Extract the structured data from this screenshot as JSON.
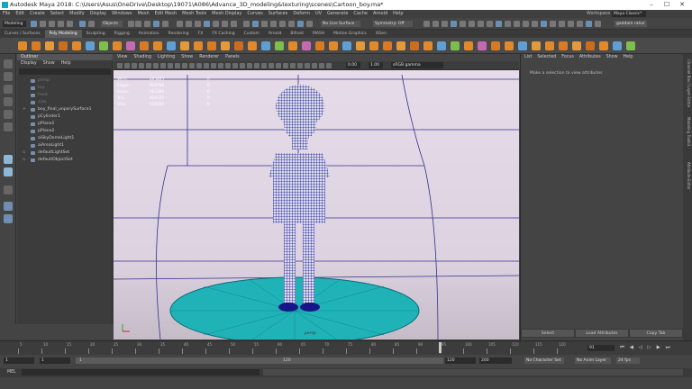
{
  "window": {
    "title": "Autodesk Maya 2018: C:\\Users\\Asus\\OneDrive\\Desktop\\19071\\A086\\Advance_3D_modeling&texturing\\scenes\\Cartoon_boy.ma*",
    "min": "–",
    "max": "☐",
    "close": "✕"
  },
  "menubar": {
    "items": [
      "File",
      "Edit",
      "Create",
      "Select",
      "Modify",
      "Display",
      "Windows",
      "Mesh",
      "Edit Mesh",
      "Mesh Tools",
      "Mesh Display",
      "Curves",
      "Surfaces",
      "Deform",
      "UV",
      "Generate",
      "Cache",
      "Arnold",
      "Help"
    ],
    "workspace_label": "Workspace :",
    "workspace_value": "Maya Classic*"
  },
  "statusline": {
    "mode": "Modeling",
    "objects": "Objects",
    "no_live_surface": "No Live Surface",
    "symmetry": "Symmetry: Off",
    "user": "gaddam rahul"
  },
  "shelf": {
    "tabs": [
      "Curves / Surfaces",
      "Poly Modeling",
      "Sculpting",
      "Rigging",
      "Animation",
      "Rendering",
      "FX",
      "FX Caching",
      "Custom",
      "Arnold",
      "Bifrost",
      "MASH",
      "Motion Graphics",
      "XGen"
    ],
    "active": "Poly Modeling"
  },
  "outliner": {
    "title": "Outliner",
    "menu": [
      "Display",
      "Show",
      "Help"
    ],
    "items": [
      {
        "label": "persp",
        "dim": true
      },
      {
        "label": "top",
        "dim": true
      },
      {
        "label": "front",
        "dim": true
      },
      {
        "label": "side",
        "dim": true
      },
      {
        "label": "boy_final_unparySurface1",
        "expand": "+"
      },
      {
        "label": "pCylinder1"
      },
      {
        "label": "pPlane1"
      },
      {
        "label": "pPlane2"
      },
      {
        "label": "aiSkyDomeLight1"
      },
      {
        "label": "aiAreaLight1"
      },
      {
        "label": "defaultLightSet",
        "expand": "▫"
      },
      {
        "label": "defaultObjectSet",
        "expand": "▫"
      }
    ]
  },
  "viewport": {
    "menu": [
      "View",
      "Shading",
      "Lighting",
      "Show",
      "Renderer",
      "Panels"
    ],
    "toolbar": {
      "value1": "0.00",
      "value2": "1.00",
      "colorspace": "sRGB gamma"
    },
    "hud": [
      {
        "label": "Verts:",
        "value": "465405",
        "num": "0"
      },
      {
        "label": "Edges:",
        "value": "928766",
        "num": "0"
      },
      {
        "label": "Faces:",
        "value": "463386",
        "num": "0"
      },
      {
        "label": "Tris:",
        "value": "926725",
        "num": "0"
      },
      {
        "label": "UVs:",
        "value": "556595",
        "num": "0"
      }
    ],
    "camera": "persp"
  },
  "attribute_editor": {
    "menu": [
      "List",
      "Selected",
      "Focus",
      "Attributes",
      "Show",
      "Help"
    ],
    "message": "Make a selection to view attributes",
    "buttons": [
      "Select",
      "Load Attributes",
      "Copy Tab"
    ],
    "side_tabs": [
      "Channel Box / Layer Editor",
      "Modeling Toolkit",
      "Attribute Editor"
    ]
  },
  "timeline": {
    "ticks": [
      "5",
      "10",
      "15",
      "20",
      "25",
      "30",
      "35",
      "40",
      "45",
      "50",
      "55",
      "60",
      "65",
      "70",
      "75",
      "80",
      "85",
      "90",
      "95",
      "100",
      "105",
      "110",
      "115",
      "120"
    ],
    "current_frame": "91"
  },
  "range": {
    "start": "1",
    "inner_start": "1",
    "inner_value": "1",
    "inner_end": "120",
    "end": "120",
    "end2": "200",
    "character_set": "No Character Set",
    "anim_layer": "No Anim Layer",
    "fps": "24 fps"
  },
  "cmdline": {
    "label": "MEL"
  },
  "colors": {
    "viewport_bg": "#e3d8e6",
    "wire": "#16168a",
    "platform": "#1fb3b8",
    "accent": "#12a9c0"
  }
}
